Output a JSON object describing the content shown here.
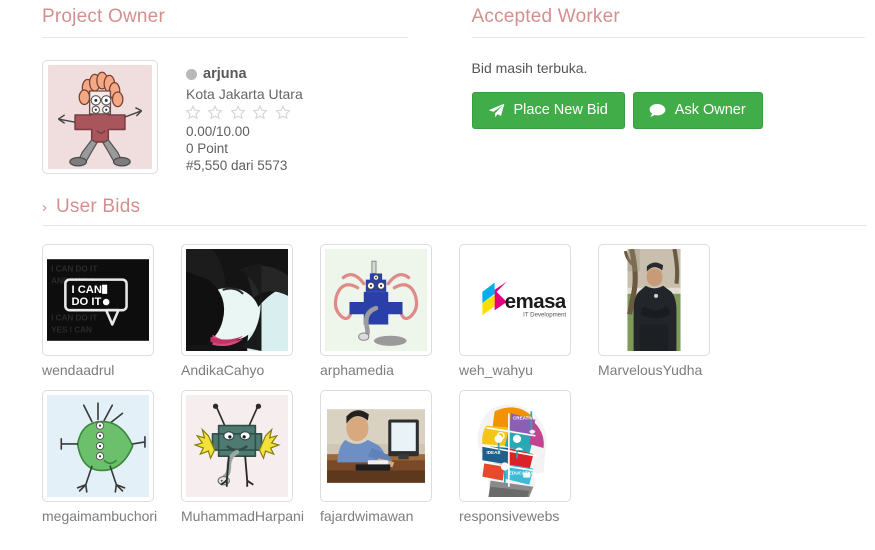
{
  "owner_section": {
    "title": "Project Owner",
    "status_icon": "circle-status-icon",
    "name": "arjuna",
    "location": "Kota Jakarta Utara",
    "stars": 5,
    "stars_filled": 0,
    "rating": "0.00/10.00",
    "points": "0 Point",
    "rank": "#5,550 dari 5573",
    "avatar_icon": "identicon-monster-avatar"
  },
  "worker_section": {
    "title": "Accepted Worker",
    "status_text": "Bid masih terbuka.",
    "buttons": [
      {
        "label": "Place New Bid",
        "icon": "paper-plane-icon",
        "name": "place-new-bid-button"
      },
      {
        "label": "Ask Owner",
        "icon": "comment-icon",
        "name": "ask-owner-button"
      }
    ]
  },
  "bids_section": {
    "title": "User Bids",
    "chevron_icon": "chevron-right-icon",
    "chevron_glyph": "›",
    "bids": [
      {
        "label": "wendaadrul",
        "thumb": "i-can-do-it-poster"
      },
      {
        "label": "AndikaCahyo",
        "thumb": "portrait-photo-dark-hair"
      },
      {
        "label": "arphamedia",
        "thumb": "identicon-blue-monster"
      },
      {
        "label": "weh_wahyu",
        "thumb": "emasa-development-logo"
      },
      {
        "label": "MarvelousYudha",
        "thumb": "portrait-photo-outdoors"
      },
      {
        "label": "megaimambuchori",
        "thumb": "identicon-green-monster"
      },
      {
        "label": "MuhammadHarpani",
        "thumb": "identicon-teal-monster"
      },
      {
        "label": "fajardwimawan",
        "thumb": "photo-man-at-desk"
      },
      {
        "label": "responsivewebs",
        "thumb": "puzzle-head-infographic"
      }
    ]
  },
  "colors": {
    "heading": "#d48f8f",
    "button_green": "#41ad49",
    "border": "#dddddd",
    "rule": "#e7e7e7",
    "label_text": "#7d7d7d",
    "status_dot": "#b8b8b8"
  }
}
